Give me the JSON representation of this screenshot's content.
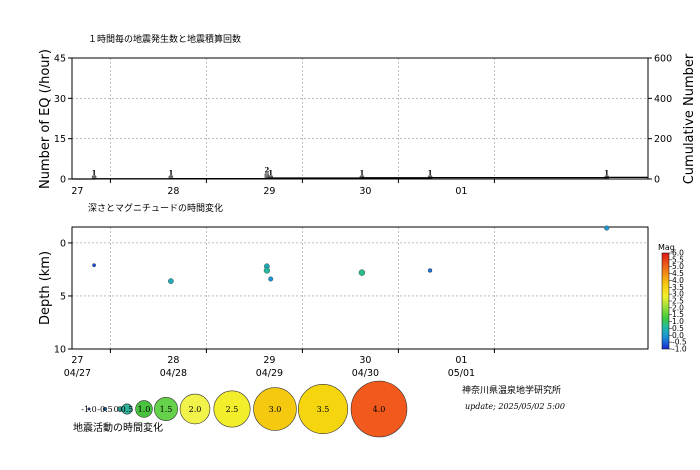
{
  "chart_data": [
    {
      "type": "bar",
      "title": "１時間毎の地震発生数と地震積算回数",
      "ylabel": "Number of EQ (/hour)",
      "y2label": "Cumulative Number",
      "ylim": [
        0,
        45
      ],
      "yticks": [
        0,
        15,
        30,
        45
      ],
      "y2lim": [
        0,
        600
      ],
      "y2ticks": [
        0,
        200,
        400,
        600
      ],
      "xlim": [
        26.6,
        32.6
      ],
      "xticks": [
        {
          "pos": 27,
          "label": "27"
        },
        {
          "pos": 28,
          "label": "28"
        },
        {
          "pos": 29,
          "label": "29"
        },
        {
          "pos": 30,
          "label": "30"
        },
        {
          "pos": 31,
          "label": "01"
        }
      ],
      "grid": true,
      "bars": [
        {
          "x": 26.83,
          "count": 1,
          "label": "1"
        },
        {
          "x": 27.63,
          "count": 1,
          "label": "1"
        },
        {
          "x": 28.63,
          "count": 2,
          "label": "2"
        },
        {
          "x": 28.67,
          "count": 1,
          "label": "1"
        },
        {
          "x": 29.62,
          "count": 1,
          "label": "1"
        },
        {
          "x": 30.33,
          "count": 1,
          "label": "1"
        },
        {
          "x": 32.17,
          "count": 1,
          "label": "1"
        }
      ],
      "cumulative": [
        [
          26.6,
          0
        ],
        [
          26.83,
          1
        ],
        [
          27.63,
          2
        ],
        [
          28.63,
          4
        ],
        [
          28.67,
          5
        ],
        [
          29.62,
          6
        ],
        [
          30.33,
          7
        ],
        [
          32.17,
          8
        ],
        [
          32.6,
          8
        ]
      ]
    },
    {
      "type": "scatter",
      "title": "深さとマグニチュードの時間変化",
      "ylabel": "Depth (km)",
      "ylim": [
        -1.5,
        10
      ],
      "yticks": [
        0,
        5,
        10
      ],
      "y_inverted": true,
      "xlim": [
        26.6,
        32.6
      ],
      "xticks": [
        {
          "pos": 27,
          "label": "27",
          "sub": "04/27"
        },
        {
          "pos": 28,
          "label": "28",
          "sub": "04/28"
        },
        {
          "pos": 29,
          "label": "29",
          "sub": "04/29"
        },
        {
          "pos": 30,
          "label": "30",
          "sub": "04/30"
        },
        {
          "pos": 31,
          "label": "01",
          "sub": "05/01"
        }
      ],
      "grid": true,
      "points": [
        {
          "x": 26.83,
          "depth": 2.1,
          "mag": -0.7
        },
        {
          "x": 27.63,
          "depth": 3.6,
          "mag": 0.3
        },
        {
          "x": 28.63,
          "depth": 2.2,
          "mag": 0.3
        },
        {
          "x": 28.63,
          "depth": 2.6,
          "mag": 0.6
        },
        {
          "x": 28.67,
          "depth": 3.4,
          "mag": -0.1
        },
        {
          "x": 29.62,
          "depth": 2.8,
          "mag": 0.7
        },
        {
          "x": 30.33,
          "depth": 2.6,
          "mag": -0.4
        },
        {
          "x": 32.17,
          "depth": -1.4,
          "mag": 0.0
        }
      ],
      "colorbar": {
        "label": "Mag",
        "min": -1.0,
        "max": 6.0,
        "ticks": [
          "6.0",
          "5.5",
          "5.0",
          "4.5",
          "4.0",
          "3.5",
          "3.0",
          "2.5",
          "2.0",
          "1.5",
          "1.0",
          "0.5",
          "0.0",
          "-0.5",
          "-1.0"
        ]
      }
    }
  ],
  "legend": {
    "title": "地震活動の時間変化",
    "items": [
      {
        "label": "-1.0",
        "mag": -1.0,
        "color": "#1e2aa8"
      },
      {
        "label": "-0.5",
        "mag": -0.5,
        "color": "#1f6fb4"
      },
      {
        "label": "0.0",
        "mag": 0.0,
        "color": "#2a9d9a"
      },
      {
        "label": "0.5",
        "mag": 0.5,
        "color": "#2fb39a"
      },
      {
        "label": "1.0",
        "mag": 1.0,
        "color": "#49c23f"
      },
      {
        "label": "1.5",
        "mag": 1.5,
        "color": "#66d14a"
      },
      {
        "label": "2.0",
        "mag": 2.0,
        "color": "#f1f24a"
      },
      {
        "label": "2.5",
        "mag": 2.5,
        "color": "#f3ee2c"
      },
      {
        "label": "3.0",
        "mag": 3.0,
        "color": "#f4c90f"
      },
      {
        "label": "3.5",
        "mag": 3.5,
        "color": "#f5d60e"
      },
      {
        "label": "4.0",
        "mag": 4.0,
        "color": "#f15a1c"
      }
    ]
  },
  "institute": "神奈川県温泉地学研究所",
  "update_text": "update; 2025/05/02  5:00"
}
